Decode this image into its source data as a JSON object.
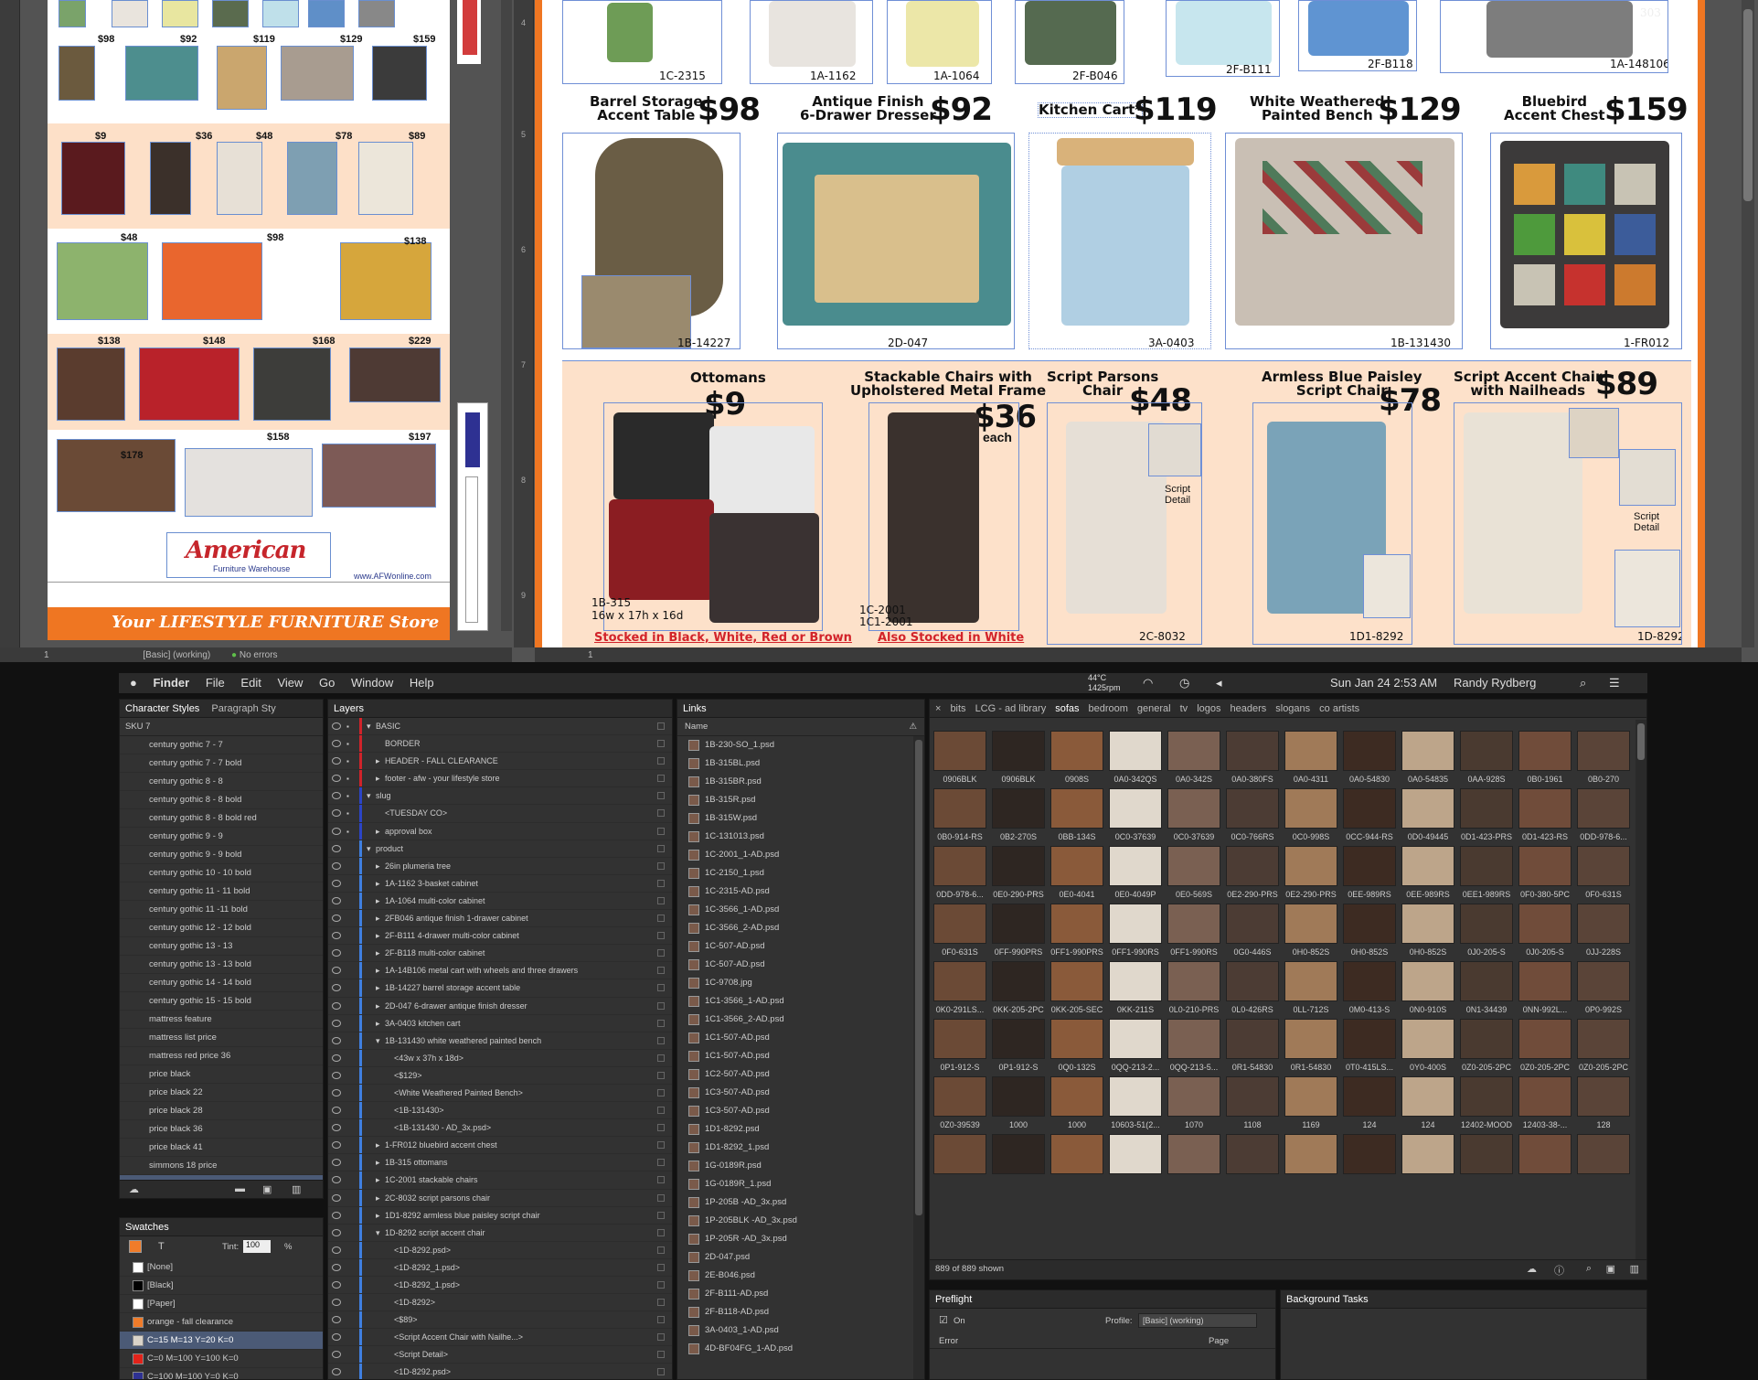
{
  "indesign": {
    "status_left": {
      "page": "1",
      "preflight": "[Basic] (working)",
      "errors": "No errors"
    },
    "status_right": {
      "page": "1"
    },
    "ruler_numbers": [
      "4",
      "5",
      "6",
      "7",
      "8",
      "9"
    ],
    "top_row_skus": [
      "1C-2315",
      "1A-1162",
      "1A-1064",
      "2F-B046",
      "2F-B111",
      "2F-B118",
      "1A-148106"
    ],
    "corner_mark": "303",
    "row2": [
      {
        "name1": "Barrel Storage",
        "name2": "Accent Table",
        "price": "$98",
        "sku": "1B-14227"
      },
      {
        "name1": "Antique Finish",
        "name2": "6-Drawer Dresser",
        "price": "$92",
        "sku": "2D-047"
      },
      {
        "name1": "Kitchen Cart*",
        "name2": "",
        "price": "$119",
        "sku": "3A-0403"
      },
      {
        "name1": "White Weathered",
        "name2": "Painted Bench",
        "price": "$129",
        "sku": "1B-131430"
      },
      {
        "name1": "Bluebird",
        "name2": "Accent Chest",
        "price": "$159",
        "sku": "1-FR012"
      }
    ],
    "row3": [
      {
        "name1": "Ottomans",
        "name2": "",
        "price": "$9",
        "sku": "1B-315",
        "dims": "16w x 17h x 16d",
        "red": "Stocked in Black, White, Red or Brown"
      },
      {
        "name1": "Stackable Chairs with",
        "name2": "Upholstered Metal Frame",
        "price": "$36",
        "each": "each",
        "sku": "1C-2001",
        "sku2": "1C1-2001",
        "red": "Also Stocked in White"
      },
      {
        "name1": "Script Parsons",
        "name2": "Chair",
        "price": "$48",
        "sku": "2C-8032",
        "detail1": "Script",
        "detail2": "Detail"
      },
      {
        "name1": "Armless Blue Paisley",
        "name2": "Script Chair",
        "price": "$78",
        "sku": "1D1-8292"
      },
      {
        "name1": "Script Accent Chair",
        "name2": "with Nailheads",
        "price": "$89",
        "sku": "1D-8292",
        "detail1": "Script",
        "detail2": "Detail"
      }
    ],
    "left_prices": [
      "$98",
      "$92",
      "$119",
      "$129",
      "$159",
      "$9",
      "$36",
      "$48",
      "$78",
      "$89",
      "$48",
      "$98",
      "$138",
      "$138",
      "$148",
      "$168",
      "$229",
      "$178",
      "$158",
      "$197"
    ],
    "left_brand": "American",
    "left_brand_sub": "Furniture Warehouse",
    "left_web": "www.AFWonline.com",
    "left_footer": "Your LIFESTYLE FURNITURE Store"
  },
  "menubar": {
    "items": [
      "Finder",
      "File",
      "Edit",
      "View",
      "Go",
      "Window",
      "Help"
    ],
    "temp": "44°C",
    "rpm": "1425rpm",
    "datetime": "Sun Jan 24  2:53 AM",
    "user": "Randy Rydberg"
  },
  "char_styles": {
    "tabs": [
      "Character Styles",
      "Paragraph Sty"
    ],
    "current": "SKU 7",
    "items": [
      "century gothic 7 - 7",
      "century gothic 7 - 7 bold",
      "century gothic 8 - 8",
      "century gothic 8 - 8 bold",
      "century gothic 8 - 8 bold red",
      "century gothic 9 - 9",
      "century gothic 9 - 9 bold",
      "century gothic 10 - 10 bold",
      "century gothic 11 - 11 bold",
      "century gothic 11 -11 bold",
      "century gothic 12 - 12 bold",
      "century gothic 13 - 13",
      "century gothic 13 - 13 bold",
      "century gothic 14 - 14 bold",
      "century gothic 15 - 15 bold",
      "mattress feature",
      "mattress list price",
      "mattress red price 36",
      "price black",
      "price black 22",
      "price black 28",
      "price black 36",
      "price black 41",
      "simmons 18 price",
      "SKU 7"
    ]
  },
  "swatches": {
    "title": "Swatches",
    "tint_label": "Tint:",
    "tint": "100",
    "pct": "%",
    "items": [
      {
        "name": "[None]",
        "color": "#ffffff"
      },
      {
        "name": "[Black]",
        "color": "#000000"
      },
      {
        "name": "[Paper]",
        "color": "#ffffff"
      },
      {
        "name": "orange - fall clearance",
        "color": "#f07c2a"
      },
      {
        "name": "C=15 M=13 Y=20 K=0",
        "color": "#d9d3c9"
      },
      {
        "name": "C=0 M=100 Y=100 K=0",
        "color": "#e2231a"
      },
      {
        "name": "C=100 M=100 Y=0 K=0",
        "color": "#2e3192"
      }
    ]
  },
  "layers": {
    "title": "Layers",
    "items": [
      {
        "label": "BASIC",
        "indent": 0,
        "bar": "#d0232a",
        "arrow": "down"
      },
      {
        "label": "BORDER",
        "indent": 1,
        "bar": "#d0232a",
        "arrow": ""
      },
      {
        "label": "HEADER - FALL CLEARANCE",
        "indent": 1,
        "bar": "#d0232a",
        "arrow": "right"
      },
      {
        "label": "footer - afw - your lifestyle store",
        "indent": 1,
        "bar": "#d0232a",
        "arrow": "right"
      },
      {
        "label": "slug",
        "indent": 0,
        "bar": "#2b44c6",
        "arrow": "down"
      },
      {
        "label": "<TUESDAY   CO>",
        "indent": 1,
        "bar": "#2b44c6",
        "arrow": ""
      },
      {
        "label": "approval box",
        "indent": 1,
        "bar": "#2b44c6",
        "arrow": "right"
      },
      {
        "label": "product",
        "indent": 0,
        "bar": "#3f7fe0",
        "arrow": "down"
      },
      {
        "label": "26in plumeria tree",
        "indent": 1,
        "bar": "#3f7fe0",
        "arrow": "right"
      },
      {
        "label": "1A-1162 3-basket cabinet",
        "indent": 1,
        "bar": "#3f7fe0",
        "arrow": "right"
      },
      {
        "label": "1A-1064 multi-color cabinet",
        "indent": 1,
        "bar": "#3f7fe0",
        "arrow": "right"
      },
      {
        "label": "2FB046 antique finish 1-drawer cabinet",
        "indent": 1,
        "bar": "#3f7fe0",
        "arrow": "right"
      },
      {
        "label": "2F-B111 4-drawer multi-color cabinet",
        "indent": 1,
        "bar": "#3f7fe0",
        "arrow": "right"
      },
      {
        "label": "2F-B118 multi-color cabinet",
        "indent": 1,
        "bar": "#3f7fe0",
        "arrow": "right"
      },
      {
        "label": "1A-14B106 metal cart with wheels and three drawers",
        "indent": 1,
        "bar": "#3f7fe0",
        "arrow": "right"
      },
      {
        "label": "1B-14227 barrel storage accent table",
        "indent": 1,
        "bar": "#3f7fe0",
        "arrow": "right"
      },
      {
        "label": "2D-047 6-drawer antique finish dresser",
        "indent": 1,
        "bar": "#3f7fe0",
        "arrow": "right"
      },
      {
        "label": "3A-0403 kitchen cart",
        "indent": 1,
        "bar": "#3f7fe0",
        "arrow": "right"
      },
      {
        "label": "1B-131430 white weathered painted bench",
        "indent": 1,
        "bar": "#3f7fe0",
        "arrow": "down"
      },
      {
        "label": "<43w x 37h x 18d>",
        "indent": 2,
        "bar": "#3f7fe0",
        "arrow": ""
      },
      {
        "label": "<$129>",
        "indent": 2,
        "bar": "#3f7fe0",
        "arrow": ""
      },
      {
        "label": "<White Weathered Painted Bench>",
        "indent": 2,
        "bar": "#3f7fe0",
        "arrow": ""
      },
      {
        "label": "<1B-131430>",
        "indent": 2,
        "bar": "#3f7fe0",
        "arrow": ""
      },
      {
        "label": "<1B-131430 - AD_3x.psd>",
        "indent": 2,
        "bar": "#3f7fe0",
        "arrow": ""
      },
      {
        "label": "1-FR012 bluebird accent chest",
        "indent": 1,
        "bar": "#3f7fe0",
        "arrow": "right"
      },
      {
        "label": "1B-315 ottomans",
        "indent": 1,
        "bar": "#3f7fe0",
        "arrow": "right"
      },
      {
        "label": "1C-2001 stackable chairs",
        "indent": 1,
        "bar": "#3f7fe0",
        "arrow": "right"
      },
      {
        "label": "2C-8032 script parsons chair",
        "indent": 1,
        "bar": "#3f7fe0",
        "arrow": "right"
      },
      {
        "label": "1D1-8292 armless blue paisley script chair",
        "indent": 1,
        "bar": "#3f7fe0",
        "arrow": "right"
      },
      {
        "label": "1D-8292 script accent chair",
        "indent": 1,
        "bar": "#3f7fe0",
        "arrow": "down"
      },
      {
        "label": "<1D-8292.psd>",
        "indent": 2,
        "bar": "#3f7fe0",
        "arrow": ""
      },
      {
        "label": "<1D-8292_1.psd>",
        "indent": 2,
        "bar": "#3f7fe0",
        "arrow": ""
      },
      {
        "label": "<1D-8292_1.psd>",
        "indent": 2,
        "bar": "#3f7fe0",
        "arrow": ""
      },
      {
        "label": "<1D-8292>",
        "indent": 2,
        "bar": "#3f7fe0",
        "arrow": ""
      },
      {
        "label": "<$89>",
        "indent": 2,
        "bar": "#3f7fe0",
        "arrow": ""
      },
      {
        "label": "<Script Accent Chair with Nailhe...>",
        "indent": 2,
        "bar": "#3f7fe0",
        "arrow": ""
      },
      {
        "label": "<Script Detail>",
        "indent": 2,
        "bar": "#3f7fe0",
        "arrow": ""
      },
      {
        "label": "<1D-8292.psd>",
        "indent": 2,
        "bar": "#3f7fe0",
        "arrow": ""
      }
    ]
  },
  "links": {
    "title": "Links",
    "col": "Name",
    "items": [
      "1B-230-SO_1.psd",
      "1B-315BL.psd",
      "1B-315BR.psd",
      "1B-315R.psd",
      "1B-315W.psd",
      "1C-131013.psd",
      "1C-2001_1-AD.psd",
      "1C-2150_1.psd",
      "1C-2315-AD.psd",
      "1C-3566_1-AD.psd",
      "1C-3566_2-AD.psd",
      "1C-507-AD.psd",
      "1C-507-AD.psd",
      "1C-9708.jpg",
      "1C1-3566_1-AD.psd",
      "1C1-3566_2-AD.psd",
      "1C1-507-AD.psd",
      "1C1-507-AD.psd",
      "1C2-507-AD.psd",
      "1C3-507-AD.psd",
      "1C3-507-AD.psd",
      "1D1-8292.psd",
      "1D1-8292_1.psd",
      "1G-0189R.psd",
      "1G-0189R_1.psd",
      "1P-205B -AD_3x.psd",
      "1P-205BLK -AD_3x.psd",
      "1P-205R -AD_3x.psd",
      "2D-047.psd",
      "2E-B046.psd",
      "2F-B111-AD.psd",
      "2F-B118-AD.psd",
      "3A-0403_1-AD.psd",
      "4D-BF04FG_1-AD.psd"
    ]
  },
  "library": {
    "tabs": [
      "bits",
      "LCG - ad library",
      "sofas",
      "bedroom",
      "general",
      "tv",
      "logos",
      "headers",
      "slogans",
      "co artists"
    ],
    "active": "sofas",
    "count": "889 of 889 shown",
    "items": [
      "0906BLK",
      "0906BLK",
      "0908S",
      "0A0-342QS",
      "0A0-342S",
      "0A0-380FS",
      "0A0-4311",
      "0A0-54830",
      "0A0-54835",
      "0AA-928S",
      "0B0-1961",
      "0B0-270",
      "0B0-914-RS",
      "0B2-270S",
      "0BB-134S",
      "0C0-37639",
      "0C0-37639",
      "0C0-766RS",
      "0C0-998S",
      "0CC-944-RS",
      "0D0-49445",
      "0D1-423-PRS",
      "0D1-423-RS",
      "0DD-978-6...",
      "0DD-978-6...",
      "0E0-290-PRS",
      "0E0-4041",
      "0E0-4049P",
      "0E0-569S",
      "0E2-290-PRS",
      "0E2-290-PRS",
      "0EE-989RS",
      "0EE-989RS",
      "0EE1-989RS",
      "0F0-380-5PC",
      "0F0-631S",
      "0F0-631S",
      "0FF-990PRS",
      "0FF1-990PRS",
      "0FF1-990RS",
      "0FF1-990RS",
      "0G0-446S",
      "0H0-852S",
      "0H0-852S",
      "0H0-852S",
      "0J0-205-S",
      "0J0-205-S",
      "0JJ-228S",
      "0K0-291LS...",
      "0KK-205-2PC",
      "0KK-205-SEC",
      "0KK-211S",
      "0L0-210-PRS",
      "0L0-426RS",
      "0LL-712S",
      "0M0-413-S",
      "0N0-910S",
      "0N1-34439",
      "0NN-992L...",
      "0P0-992S",
      "0P1-912-S",
      "0P1-912-S",
      "0Q0-132S",
      "0QQ-213-2...",
      "0QQ-213-5...",
      "0R1-54830",
      "0R1-54830",
      "0T0-415LS...",
      "0Y0-400S",
      "0Z0-205-2PC",
      "0Z0-205-2PC",
      "0Z0-205-2PC",
      "0Z0-39539",
      "1000",
      "1000",
      "10603-51(2...",
      "1070",
      "1108",
      "1169",
      "124",
      "124",
      "12402-MOOD",
      "12403-38-...",
      "128",
      "",
      "",
      "",
      "",
      "",
      "",
      "",
      "",
      "",
      "",
      "",
      ""
    ]
  },
  "preflight": {
    "title": "Preflight",
    "on": "On",
    "profile_label": "Profile:",
    "profile": "[Basic] (working)",
    "col_error": "Error",
    "col_page": "Page"
  },
  "background_tasks": {
    "title": "Background Tasks"
  }
}
